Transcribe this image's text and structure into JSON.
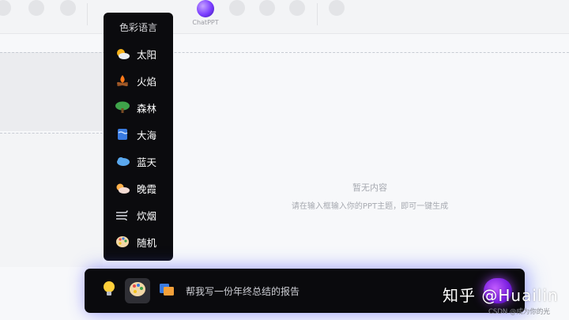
{
  "toolbar": {
    "chatppt_label": "ChatPPT"
  },
  "empty_state": {
    "title": "暂无内容",
    "hint": "请在输入框输入你的PPT主题，即可一键生成"
  },
  "color_menu": {
    "title": "色彩语言",
    "items": [
      {
        "label": "太阳",
        "icon": "sun-behind-cloud-icon"
      },
      {
        "label": "火焰",
        "icon": "campfire-icon"
      },
      {
        "label": "森林",
        "icon": "tree-icon"
      },
      {
        "label": "大海",
        "icon": "wave-scroll-icon"
      },
      {
        "label": "蓝天",
        "icon": "cloud-icon"
      },
      {
        "label": "晚霞",
        "icon": "sunset-cloud-icon"
      },
      {
        "label": "炊烟",
        "icon": "wind-icon"
      },
      {
        "label": "随机",
        "icon": "palette-icon"
      }
    ]
  },
  "prompt_bar": {
    "input_value": "帮我写一份年终总结的报告"
  },
  "watermark": {
    "main": "知乎 @Huailin",
    "sub": "CSDN @成为你的光"
  },
  "colors": {
    "menu_bg": "#0b0b0e",
    "accent": "#7a1fe0"
  }
}
